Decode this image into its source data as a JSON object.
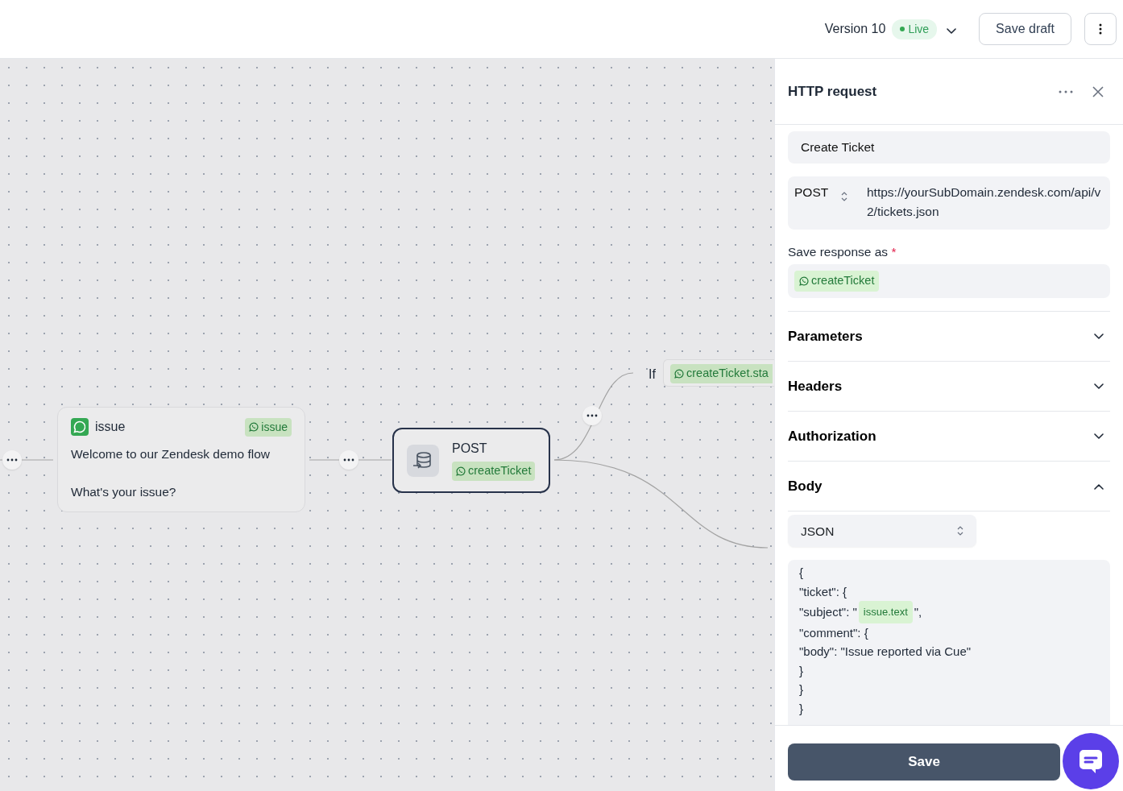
{
  "header": {
    "version": "Version 10",
    "status": "Live",
    "live": true,
    "save_draft": "Save draft"
  },
  "canvas": {
    "message_node": {
      "title": "issue",
      "tag": "issue",
      "lines": [
        "Welcome to our Zendesk demo flow",
        "What's your issue?"
      ]
    },
    "request_node": {
      "method": "POST",
      "tag": "createTicket",
      "selected": true
    },
    "condition": {
      "label": "If",
      "tag": "createTicket.sta"
    }
  },
  "panel": {
    "title": "HTTP request",
    "name": "Create Ticket",
    "method": "POST",
    "url": "https://yourSubDomain.zendesk.com/api/v2/tickets.json",
    "save_label": "Save response as",
    "required": true,
    "required_mark": "*",
    "save_var": "createTicket",
    "sections": [
      {
        "title": "Parameters",
        "expanded": false
      },
      {
        "title": "Headers",
        "expanded": false
      },
      {
        "title": "Authorization",
        "expanded": false
      },
      {
        "title": "Body",
        "expanded": true
      }
    ],
    "body_type": "JSON",
    "body_lines": [
      [
        {
          "kind": "text",
          "text": "{"
        }
      ],
      [
        {
          "kind": "text",
          "text": "\"ticket\": {"
        }
      ],
      [
        {
          "kind": "text",
          "text": "\"subject\": \""
        },
        {
          "kind": "var",
          "text": "issue.text"
        },
        {
          "kind": "text",
          "text": "\","
        }
      ],
      [
        {
          "kind": "text",
          "text": "\"comment\": {"
        }
      ],
      [
        {
          "kind": "text",
          "text": "\"body\": \"Issue reported via Cue\""
        }
      ],
      [
        {
          "kind": "text",
          "text": "}"
        }
      ],
      [
        {
          "kind": "text",
          "text": "}"
        }
      ],
      [
        {
          "kind": "text",
          "text": "}"
        }
      ]
    ],
    "save": "Save"
  }
}
